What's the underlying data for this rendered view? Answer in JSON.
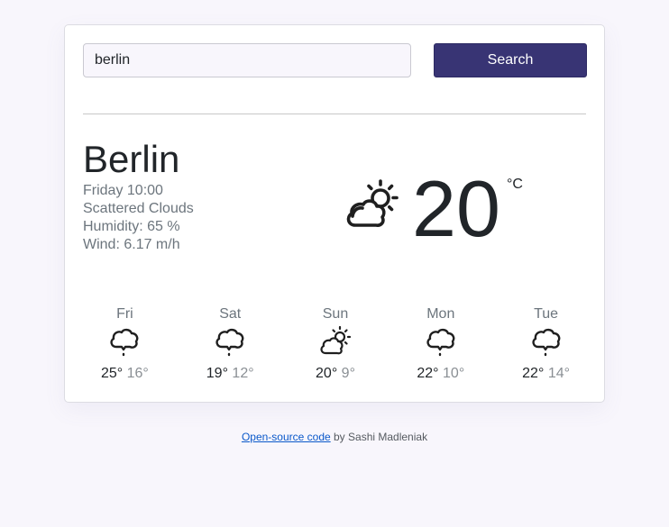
{
  "search": {
    "value": "berlin",
    "placeholder": "",
    "button_label": "Search"
  },
  "current": {
    "city": "Berlin",
    "datetime": "Friday 10:00",
    "description": "Scattered Clouds",
    "humidity": "Humidity: 65 %",
    "wind": "Wind: 6.17 m/h",
    "temperature": "20",
    "unit": "°C",
    "icon": "partly-cloudy-icon"
  },
  "forecast": [
    {
      "day": "Fri",
      "icon": "cloud-drizzle-icon",
      "high": "25°",
      "low": "16°"
    },
    {
      "day": "Sat",
      "icon": "cloud-drizzle-icon",
      "high": "19°",
      "low": "12°"
    },
    {
      "day": "Sun",
      "icon": "partly-cloudy-icon",
      "high": "20°",
      "low": "9°"
    },
    {
      "day": "Mon",
      "icon": "cloud-drizzle-icon",
      "high": "22°",
      "low": "10°"
    },
    {
      "day": "Tue",
      "icon": "cloud-drizzle-icon",
      "high": "22°",
      "low": "14°"
    }
  ],
  "footer": {
    "link_text": "Open-source code",
    "suffix": " by Sashi Madleniak"
  },
  "colors": {
    "background": "#f8f6fc",
    "button": "#383474",
    "text": "#212529",
    "muted": "#6c757d",
    "link": "#0a58ca"
  }
}
